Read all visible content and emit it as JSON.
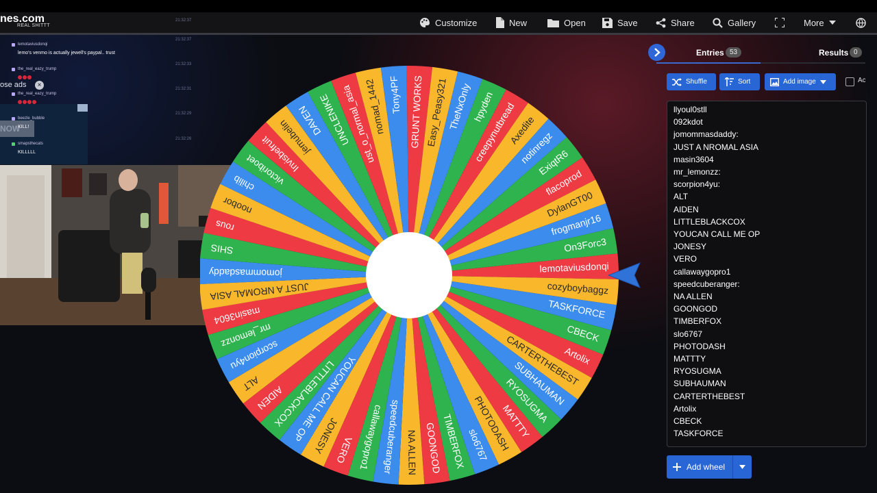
{
  "toolbar": {
    "logo": "nes.com",
    "logo_sub": "REAL SHITTT",
    "items": [
      "Customize",
      "New",
      "Open",
      "Save",
      "Share",
      "Gallery",
      "More"
    ]
  },
  "chat": {
    "messages": [
      {
        "user": "",
        "text": "",
        "time": "21:32:37"
      },
      {
        "user": "lemotaviusdonqi",
        "text": "lemo's venmo is actually jewell's paypal.. trust",
        "time": "21:32:37"
      },
      {
        "user": "the_real_eazy_trump",
        "text": "",
        "time": "21:32:33"
      },
      {
        "user": "the_real_eazy_trump",
        "text": "",
        "time": "21:32:31"
      },
      {
        "user": "beezle_bubble",
        "text": "KILL!",
        "time": "21:32:29"
      },
      {
        "user": "smapsthecats",
        "text": "KILLLLL",
        "time": "21:32:26"
      }
    ],
    "ad_label": "ose ads",
    "ad_now": "NOW"
  },
  "wheel": {
    "entries": [
      "GRUNT WORKS",
      "Easy_Peasy321",
      "TheNxOnly",
      "hpyden",
      "creepynutbread",
      "Axedite",
      "notinregz",
      "ExiqtR6",
      "flacoprod",
      "DylanGT00",
      "frogmanjr16",
      "On3Forc3",
      "lemotaviusdonqi",
      "cozyboybaggz",
      "TASKFORCE",
      "CBECK",
      "Artolix",
      "CARTERTHEBEST",
      "SUBHAUMAN",
      "RYOSUGMA",
      "MATTTY",
      "PHOTODASH",
      "slo6767",
      "TIMBERFOX",
      "GOONGOD",
      "NA ALLEN",
      "speedcuberanger",
      "callawaygopro1",
      "VERO",
      "JONESY",
      "YOUCAN CALL ME OP",
      "LITTLEBLACKCOX",
      "AIDEN",
      "ALT",
      "scorpion4yu",
      "mr_lemonzz",
      "masin3604",
      "JUST A NROMAL ASIA",
      "jomommasdaddy",
      "SHIS",
      "rous",
      "noobor",
      "chilib",
      "victoriboet",
      "Invisbefruit",
      "jemubelin",
      "DAVEN",
      "UNCLENIKE",
      "ust_o_normal_asia",
      "nomad_1442",
      "Tony4PF"
    ],
    "colors": [
      "#ee3a43",
      "#f9b72c",
      "#3b8ced",
      "#2fb34e"
    ],
    "hub_color": "#ffffff"
  },
  "panel": {
    "entries_tab": "Entries",
    "entries_count": "53",
    "results_tab": "Results",
    "results_count": "0",
    "shuffle": "Shuffle",
    "sort": "Sort",
    "add_image": "Add image",
    "advanced": "Ac",
    "add_wheel": "Add wheel",
    "list": [
      "llyoul0stll",
      "092kdot",
      "jomommasdaddy:",
      "JUST A NROMAL ASIA",
      "masin3604",
      "mr_lemonzz:",
      "scorpion4yu:",
      "ALT",
      "AIDEN",
      "LITTLEBLACKCOX",
      "YOUCAN CALL ME OP",
      "JONESY",
      "VERO",
      "callawaygopro1",
      "speedcuberanger:",
      "NA ALLEN",
      "GOONGOD",
      "TIMBERFOX",
      "slo6767",
      "PHOTODASH",
      "MATTTY",
      "RYOSUGMA",
      "SUBHAUMAN",
      "CARTERTHEBEST",
      "Artolix",
      "CBECK",
      "TASKFORCE"
    ]
  }
}
